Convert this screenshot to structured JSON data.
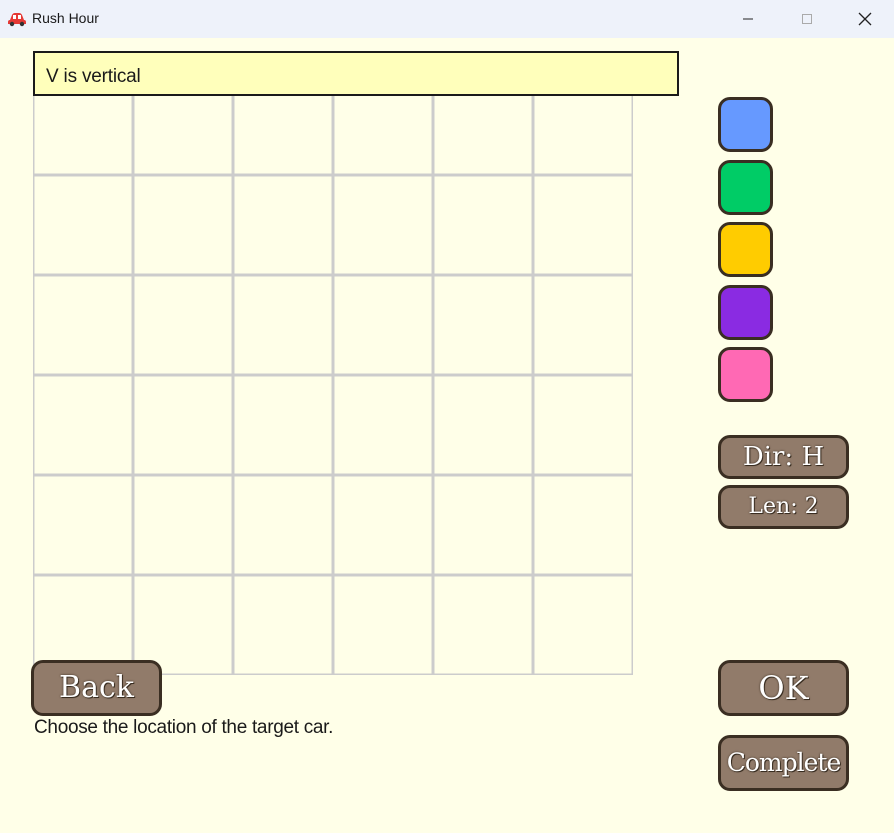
{
  "window": {
    "title": "Rush Hour",
    "icon": "red-car-icon",
    "controls": [
      "minimize-icon",
      "maximize-icon",
      "close-icon"
    ]
  },
  "message": {
    "text": "V is vertical"
  },
  "board": {
    "rows": 6,
    "cols": 6,
    "grid_color": "#cccccc"
  },
  "palette": {
    "colors": [
      "#6699ff",
      "#00cc66",
      "#ffcc00",
      "#8a2be2",
      "#ff69b4"
    ]
  },
  "controls": {
    "dir_label": "Dir: H",
    "len_label": "Len: 2"
  },
  "buttons": {
    "back_label": "Back",
    "ok_label": "OK",
    "complete_label": "Complete"
  },
  "instruction": "Choose the location of the target car.",
  "theme": {
    "background": "#ffffe8",
    "message_bg": "#ffffbb",
    "button_bg": "#917b6a",
    "button_border": "#3a2e22"
  }
}
